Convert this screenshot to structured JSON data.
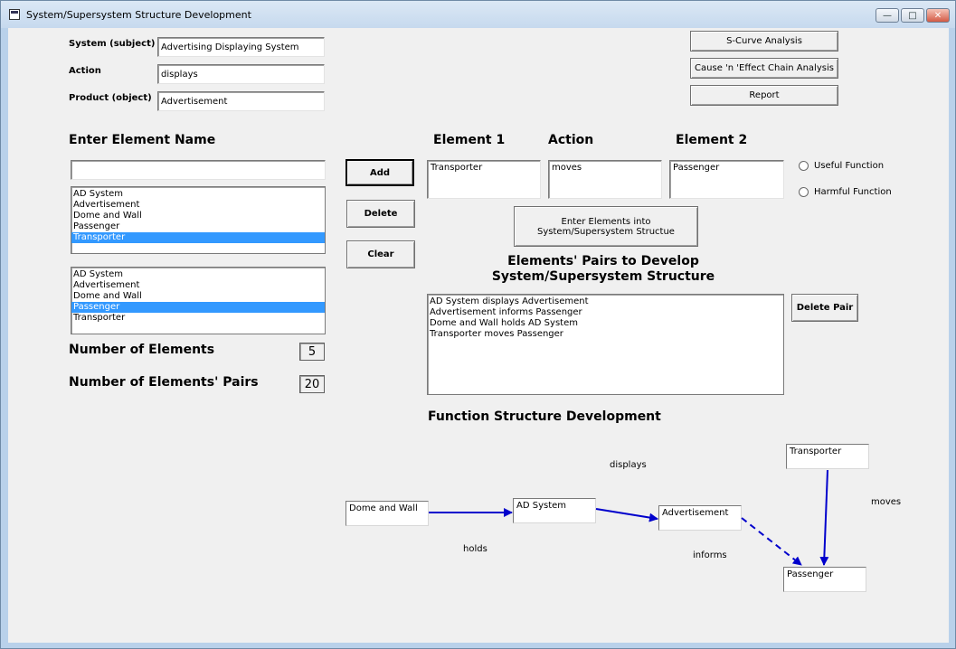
{
  "window": {
    "title": "System/Supersystem Structure Development",
    "min_glyph": "—",
    "max_glyph": "□",
    "close_glyph": "✕"
  },
  "header": {
    "system_label": "System (subject)",
    "system_value": "Advertising Displaying System",
    "action_label": "Action",
    "action_value": "displays",
    "product_label": "Product (object)",
    "product_value": "Advertisement"
  },
  "analysis_buttons": {
    "scurve": "S-Curve Analysis",
    "cause_effect": "Cause 'n 'Effect Chain Analysis",
    "report": "Report"
  },
  "left": {
    "enter_name_label": "Enter Element Name",
    "name_input_value": "",
    "list1": [
      "AD System",
      "Advertisement",
      "Dome and Wall",
      "Passenger",
      "Transporter"
    ],
    "list1_selected": "Transporter",
    "list2": [
      "AD System",
      "Advertisement",
      "Dome and Wall",
      "Passenger",
      "Transporter"
    ],
    "list2_selected": "Passenger",
    "num_elements_label": "Number of Elements",
    "num_elements_value": "5",
    "num_pairs_label": "Number of Elements' Pairs",
    "num_pairs_value": "20"
  },
  "mid_buttons": {
    "add": "Add",
    "delete": "Delete",
    "clear": "Clear"
  },
  "pair_editor": {
    "element1_label": "Element 1",
    "action_label": "Action",
    "element2_label": "Element 2",
    "element1_value": "Transporter",
    "action_value": "moves",
    "element2_value": "Passenger",
    "useful_function": "Useful Function",
    "harmful_function": "Harmful Function",
    "enter_button": "Enter Elements into System/Supersystem Structue"
  },
  "pairs": {
    "heading_line1": "Elements' Pairs to Develop",
    "heading_line2": "System/Supersystem Structure",
    "items": [
      "AD System displays Advertisement",
      "Advertisement informs Passenger",
      "Dome and Wall holds AD System",
      "Transporter moves Passenger"
    ],
    "delete_pair": "Delete Pair"
  },
  "function_structure": {
    "heading": "Function Structure Development",
    "nodes": {
      "dome": "Dome and Wall",
      "adsystem": "AD System",
      "advertisement": "Advertisement",
      "transporter": "Transporter",
      "passenger": "Passenger"
    },
    "edges": {
      "holds": "holds",
      "displays": "displays",
      "informs": "informs",
      "moves": "moves"
    },
    "arrow_color": "#0000cc"
  }
}
